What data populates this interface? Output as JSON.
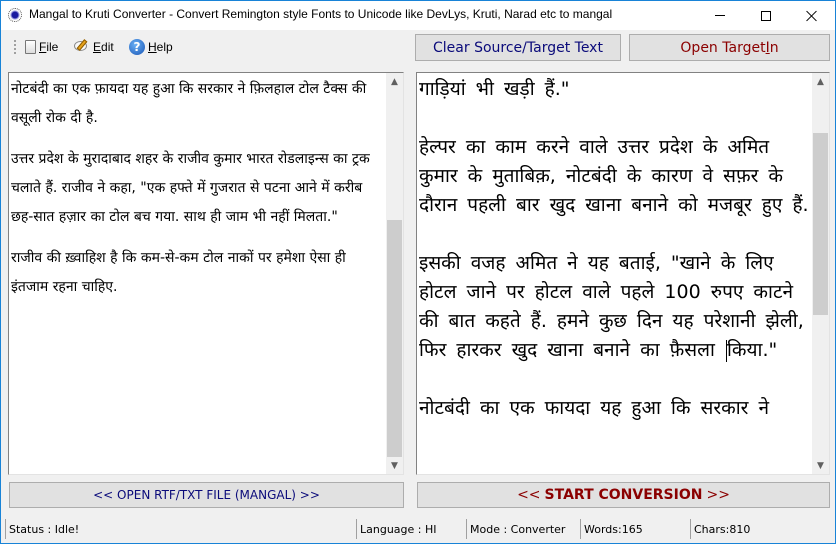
{
  "window": {
    "title": "Mangal to Kruti Converter - Convert Remington style Fonts to Unicode like DevLys, Kruti, Narad etc to mangal"
  },
  "menu": {
    "items": [
      {
        "label": "File",
        "accel": "F",
        "rest": "ile",
        "icon": "file-icon"
      },
      {
        "label": "Edit",
        "accel": "E",
        "rest": "dit",
        "icon": "edit-icon"
      },
      {
        "label": "Help",
        "accel": "H",
        "rest": "elp",
        "icon": "help-icon"
      }
    ],
    "help_glyph": "?"
  },
  "toolbar": {
    "clear_label": "Clear Source/Target Text",
    "open_target_label_pre": "Open Target ",
    "open_target_accel": "I",
    "open_target_label_post": "n",
    "open_target_label": "Open Target In"
  },
  "source": {
    "paragraphs": [
      "नोटबंदी का एक फ़ायदा यह हुआ कि सरकार ने फ़िलहाल टोल टैक्स की वसूली रोक दी है.",
      "उत्तर प्रदेश के मुरादाबाद शहर के राजीव कुमार भारत रोडलाइन्स का ट्रक चलाते हैं. राजीव ने कहा, \"एक हफ्ते में गुजरात से पटना आने में करीब छह-सात हज़ार का टोल बच गया. साथ ही जाम भी नहीं मिलता.\"",
      "राजीव की ख़्वाहिश है कि कम-से-कम टोल नाकों पर हमेशा ऐसा ही इंतजाम रहना चाहिए."
    ]
  },
  "target": {
    "paragraphs": [
      "गाड़ियां भी खड़ी हैं.\"",
      "हेल्पर का काम करने वाले उत्तर प्रदेश के अमित कुमार के मुताबिक़, नोटबंदी के कारण वे सफ़र के दौरान पहली बार खुद खाना बनाने को मजबूर हुए हैं.",
      "इसकी वजह अमित ने यह बताई, \"खाने के लिए होटल जाने पर होटल वाले पहले 100 रुपए काटने की बात कहते हैं. हमने कुछ दिन यह परेशानी झेली, फिर हारकर खुद खाना बनाने का फ़ैसला ",
      "नोटबंदी का एक फायदा यह हुआ कि सरकार ने"
    ],
    "caret_tail": "किया.\""
  },
  "actions": {
    "open_file_label": "<< OPEN RTF/TXT FILE (MANGAL) >>",
    "convert_pre": "<<",
    "convert_main": "START CONVERSION",
    "convert_post": ">>"
  },
  "status": {
    "status": "Status :  Idle!",
    "language": "Language : HI",
    "mode": "Mode : Converter",
    "words": "Words:165",
    "chars": "Chars:810"
  },
  "scroll": {
    "source_position_fraction": 0.6,
    "target_position_fraction": 0.15
  },
  "colors": {
    "accent_border": "#1883d7",
    "blue_button_text": "#0a0a7a",
    "red_button_text": "#8b0000"
  }
}
